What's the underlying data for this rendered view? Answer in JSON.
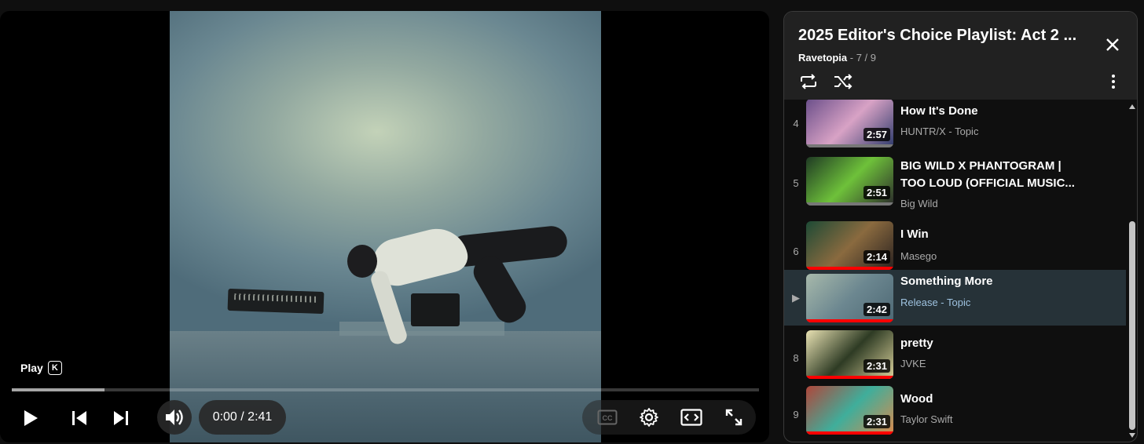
{
  "player": {
    "tooltip": "Play",
    "tooltip_key": "K",
    "time_display": "0:00 / 2:41",
    "progress_loaded_fraction": 0.124,
    "controls": [
      "play-icon",
      "previous-icon",
      "next-icon",
      "volume-icon",
      "captions-icon",
      "settings-icon",
      "theater-mode-icon",
      "fullscreen-icon"
    ]
  },
  "playlist": {
    "title": "2025 Editor's Choice Playlist: Act 2 ...",
    "owner": "Ravetopia",
    "position": " - 7 / 9",
    "items": [
      {
        "index": "4",
        "title": "How It's Done",
        "channel": "HUNTR/X - Topic",
        "duration": "2:57",
        "watched": false,
        "colors": [
          "#6b4f8a",
          "#d8a2c5",
          "#2d3a6b"
        ]
      },
      {
        "index": "5",
        "title": "BIG WILD X PHANTOGRAM | TOO LOUD (OFFICIAL MUSIC...",
        "channel": "Big Wild",
        "duration": "2:51",
        "watched": false,
        "colors": [
          "#1f3a24",
          "#6ec13a",
          "#2b2b2b"
        ]
      },
      {
        "index": "6",
        "title": "I Win",
        "channel": "Masego",
        "duration": "2:14",
        "watched": true,
        "colors": [
          "#1d4a35",
          "#8a6a3f",
          "#2a2220"
        ]
      },
      {
        "index": "▶",
        "title": "Something More",
        "channel": "Release - Topic",
        "duration": "2:42",
        "watched": true,
        "active": true,
        "colors": [
          "#a7b9ab",
          "#6c8790",
          "#4d6874"
        ]
      },
      {
        "index": "8",
        "title": "pretty",
        "channel": "JVKE",
        "duration": "2:31",
        "watched": true,
        "colors": [
          "#e9e2b3",
          "#2e3b24",
          "#d8d09a"
        ]
      },
      {
        "index": "9",
        "title": "Wood",
        "channel": "Taylor Swift",
        "duration": "2:31",
        "watched": true,
        "colors": [
          "#b0463a",
          "#3fae9b",
          "#d98a4d"
        ]
      }
    ]
  },
  "colors": {
    "accent_red": "#ff0000",
    "active_row": "#263238"
  }
}
